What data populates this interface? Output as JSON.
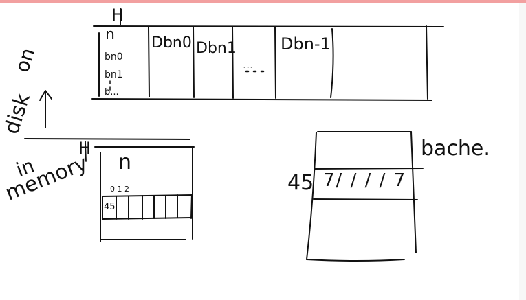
{
  "colors": {
    "ink": "#111111",
    "top_accent": "#f2a0a0"
  },
  "disk": {
    "label_H": "H",
    "n": "n",
    "b_lines": [
      "bn0",
      "bn1",
      "b..."
    ],
    "cells": [
      "Dbn0",
      "Dbn1",
      "...",
      "Dbn-1"
    ]
  },
  "labels": {
    "on_disk_1": "on",
    "on_disk_2": "disk",
    "in_memory_1": "in",
    "in_memory_2": "memory"
  },
  "memory": {
    "label_H": "H",
    "n": "n",
    "indices": "0 1 2",
    "first_cell": "45"
  },
  "cache": {
    "title": "bache.",
    "row_label": "45",
    "row_marks": "7/ / / / 7"
  }
}
